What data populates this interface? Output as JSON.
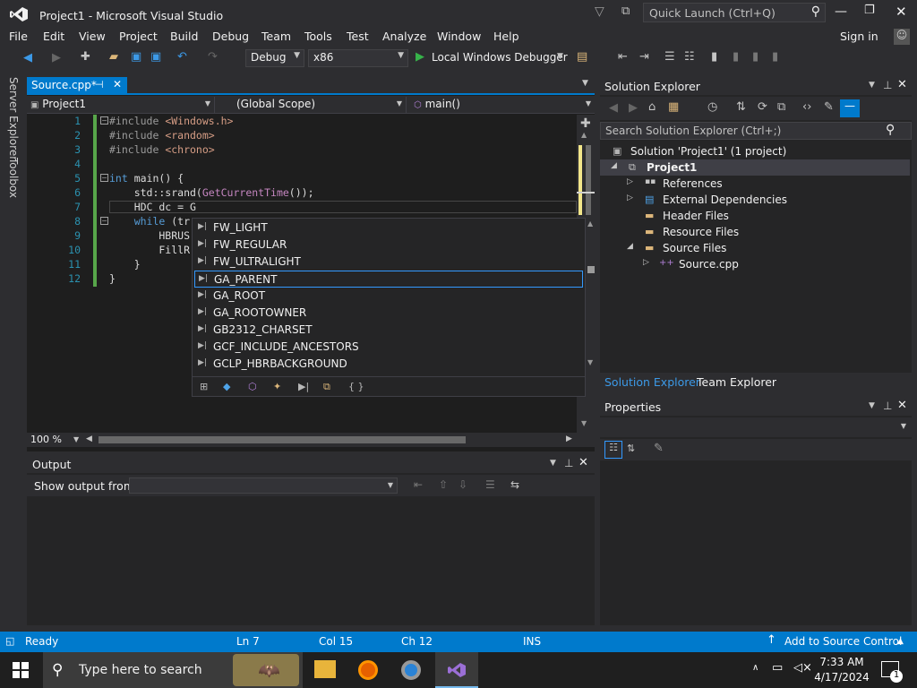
{
  "window": {
    "title": "Project1 - Microsoft Visual Studio"
  },
  "quick_launch": {
    "placeholder": "Quick Launch (Ctrl+Q)"
  },
  "menu": [
    "File",
    "Edit",
    "View",
    "Project",
    "Build",
    "Debug",
    "Team",
    "Tools",
    "Test",
    "Analyze",
    "Window",
    "Help"
  ],
  "sign_in": "Sign in",
  "toolbar": {
    "config": "Debug",
    "platform": "x86",
    "run_label": "Local Windows Debugger"
  },
  "side_tabs": {
    "server_explorer": "Server Explorer",
    "toolbox": "Toolbox"
  },
  "editor": {
    "tab": "Source.cpp*",
    "nav_project": "Project1",
    "nav_scope": "(Global Scope)",
    "nav_member": "main()",
    "zoom": "100 %",
    "line_numbers": [
      "1",
      "2",
      "3",
      "4",
      "5",
      "6",
      "7",
      "8",
      "9",
      "10",
      "11",
      "12"
    ],
    "lines": [
      {
        "pp": "#include ",
        "str": "<Windows.h>"
      },
      {
        "pp": "#include ",
        "str": "<random>"
      },
      {
        "pp": "#include ",
        "str": "<chrono>"
      },
      {
        "text": ""
      },
      {
        "kw": "int",
        "rest": " main() {"
      },
      {
        "pre": "    std::srand(",
        "fn": "GetCurrentTime",
        "post": "());"
      },
      {
        "text": "    HDC dc = G"
      },
      {
        "kw": "    while",
        "rest": " (tr"
      },
      {
        "text": "        HBRUS"
      },
      {
        "text": "        FillR"
      },
      {
        "text": "    }"
      },
      {
        "text": "}"
      }
    ]
  },
  "completion": {
    "items": [
      "FW_LIGHT",
      "FW_REGULAR",
      "FW_ULTRALIGHT",
      "GA_PARENT",
      "GA_ROOT",
      "GA_ROOTOWNER",
      "GB2312_CHARSET",
      "GCF_INCLUDE_ANCESTORS",
      "GCLP_HBRBACKGROUND"
    ],
    "selected_index": 3
  },
  "output": {
    "title": "Output",
    "show_output_from": "Show output from:"
  },
  "solution_explorer": {
    "title": "Solution Explorer",
    "search_placeholder": "Search Solution Explorer (Ctrl+;)",
    "solution": "Solution 'Project1' (1 project)",
    "project": "Project1",
    "nodes": [
      "References",
      "External Dependencies",
      "Header Files",
      "Resource Files",
      "Source Files",
      "Source.cpp"
    ],
    "tabs": [
      "Solution Explorer",
      "Team Explorer"
    ]
  },
  "properties": {
    "title": "Properties"
  },
  "status": {
    "ready": "Ready",
    "ln": "Ln 7",
    "col": "Col 15",
    "ch": "Ch 12",
    "ins": "INS",
    "source_control": "Add to Source Control"
  },
  "taskbar": {
    "search_placeholder": "Type here to search",
    "time": "7:33 AM",
    "date": "4/17/2024",
    "notif_count": "1"
  },
  "colors": {
    "accent": "#007acc",
    "bg": "#2d2d30",
    "editor_bg": "#1e1e1e"
  }
}
